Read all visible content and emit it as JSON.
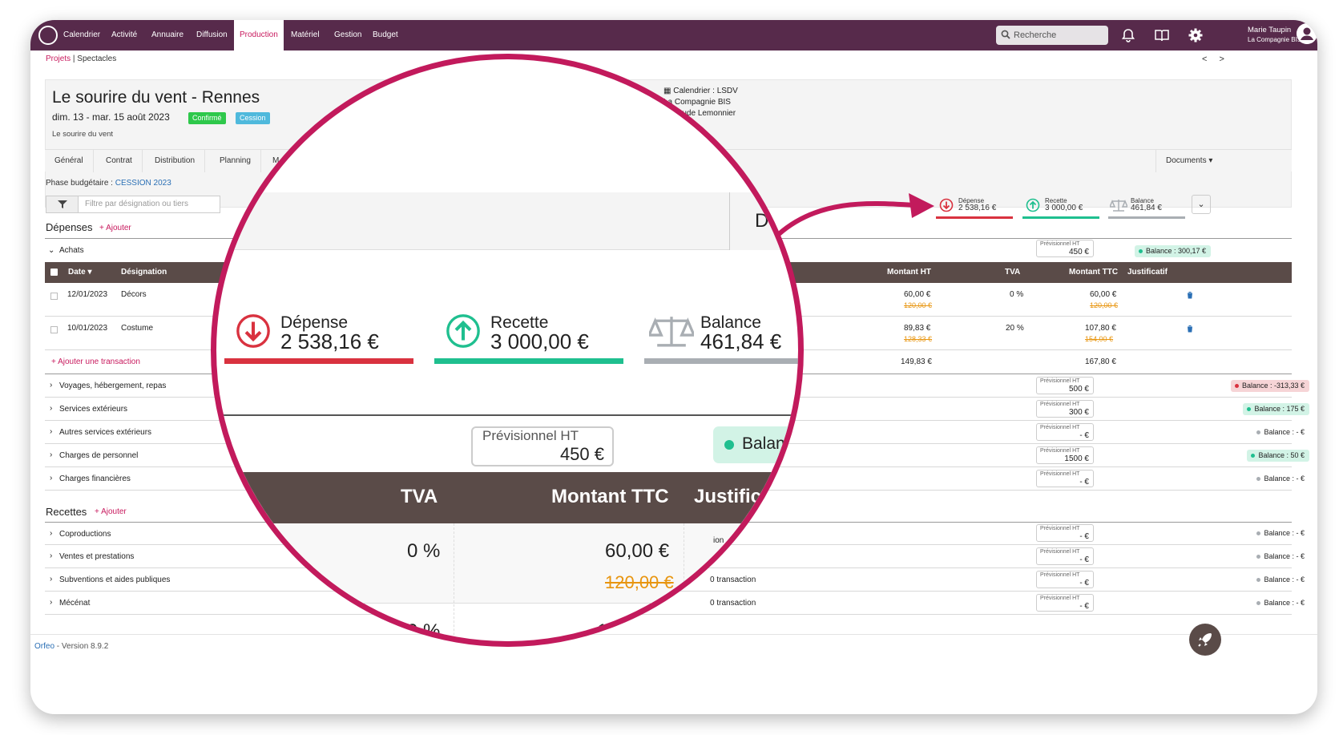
{
  "nav": {
    "items": [
      "Calendrier",
      "Activité",
      "Annuaire",
      "Diffusion",
      "Production",
      "Matériel",
      "Gestion",
      "Budget"
    ],
    "active": "Production",
    "search_placeholder": "Recherche",
    "user_name": "Marie Taupin",
    "user_company": "La Compagnie BIS"
  },
  "breadcrumb": {
    "root": "Projets",
    "sep": " | ",
    "current": "Spectacles"
  },
  "pager": "< >",
  "event": {
    "title": "Le sourire du vent - Rennes",
    "dates": "dim. 13 - mar. 15 août 2023",
    "badge_status": "Confirmé",
    "badge_type": "Cession",
    "subtitle": "Le sourire du vent",
    "meta_calendar": "Calendrier : LSDV",
    "meta_company": "La Compagnie BIS",
    "meta_author": "par Aude Lemonnier"
  },
  "tabs": [
    "Général",
    "Contrat",
    "Distribution",
    "Planning",
    "M"
  ],
  "documents_label": "Documents",
  "phase": {
    "label": "Phase budgétaire : ",
    "value": "CESSION 2023"
  },
  "filter_placeholder": "Filtre par désignation ou tiers",
  "depenses": {
    "title": "Dépenses",
    "add": "+ Ajouter"
  },
  "recettes": {
    "title": "Recettes",
    "add": "+ Ajouter"
  },
  "summary": {
    "depense": {
      "label": "Dépense",
      "value": "2 538,16 €",
      "color": "#d9323f"
    },
    "recette": {
      "label": "Recette",
      "value": "3 000,00 €",
      "color": "#1fbf8f"
    },
    "balance": {
      "label": "Balance",
      "value": "461,84 €",
      "color": "#a9aeb3"
    }
  },
  "achats": {
    "label": "Achats",
    "prev_label": "Prévisionnel HT",
    "prev_value": "450 €",
    "balance": "Balance : 300,17 €",
    "headers": {
      "date": "Date",
      "designation": "Désignation",
      "montant_ht": "Montant HT",
      "tva": "TVA",
      "montant_ttc": "Montant TTC",
      "justificatif": "Justificatif"
    },
    "rows": [
      {
        "date": "12/01/2023",
        "designation": "Décors",
        "ht": "60,00 €",
        "ht_old": "120,00 €",
        "tva": "0 %",
        "ttc": "60,00 €",
        "ttc_old": "120,00 €"
      },
      {
        "date": "10/01/2023",
        "designation": "Costume",
        "ht": "89,83 €",
        "ht_old": "128,33 €",
        "tva": "20 %",
        "ttc": "107,80 €",
        "ttc_old": "154,00 €"
      }
    ],
    "add_transaction": "+ Ajouter une transaction",
    "total_ht": "149,83 €",
    "total_ttc": "167,80 €"
  },
  "depense_cats": [
    {
      "label": "Voyages, hébergement, repas",
      "prev": "500 €",
      "balance": "Balance : -313,33 €",
      "bal_color": "#f6d4d6",
      "dot": "#d9323f"
    },
    {
      "label": "Services extérieurs",
      "prev": "300 €",
      "balance": "Balance : 175 €",
      "bal_color": "#d2f3e6",
      "dot": "#1fbf8f"
    },
    {
      "label": "Autres services extérieurs",
      "prev": "- €",
      "balance": "Balance : - €",
      "bal_color": "transparent",
      "dot": "#a9aeb3"
    },
    {
      "label": "Charges de personnel",
      "prev": "1500 €",
      "balance": "Balance : 50 €",
      "bal_color": "#d2f3e6",
      "dot": "#1fbf8f"
    },
    {
      "label": "Charges financières",
      "prev": "- €",
      "balance": "Balance : - €",
      "bal_color": "transparent",
      "dot": "#a9aeb3"
    }
  ],
  "recette_cats": [
    {
      "label": "Coproductions",
      "prev": "- €",
      "balance": "Balance : - €",
      "tx": ""
    },
    {
      "label": "Ventes et prestations",
      "prev": "- €",
      "balance": "Balance : - €",
      "tx": ""
    },
    {
      "label": "Subventions et aides publiques",
      "prev": "- €",
      "balance": "Balance : - €",
      "tx": "0 transaction"
    },
    {
      "label": "Mécénat",
      "prev": "- €",
      "balance": "Balance : - €",
      "tx": "0 transaction"
    }
  ],
  "footer": {
    "brand": "Orfeo",
    "version": " - Version 8.9.2"
  },
  "lens": {
    "partial_header": "D",
    "prev_label": "Prévisionnel HT",
    "prev_value": "450  €",
    "balance_partial": "Balan",
    "th_tva": "TVA",
    "th_ttc": "Montant TTC",
    "th_just": "Justifica",
    "tva": "0 %",
    "ttc": "60,00 €",
    "ttc_old": "120,00 €",
    "partial_tx1": "ion",
    "partial_tx2": "nsaction",
    "bottom_partial1": "0 %",
    "bottom_partial2": "10"
  }
}
